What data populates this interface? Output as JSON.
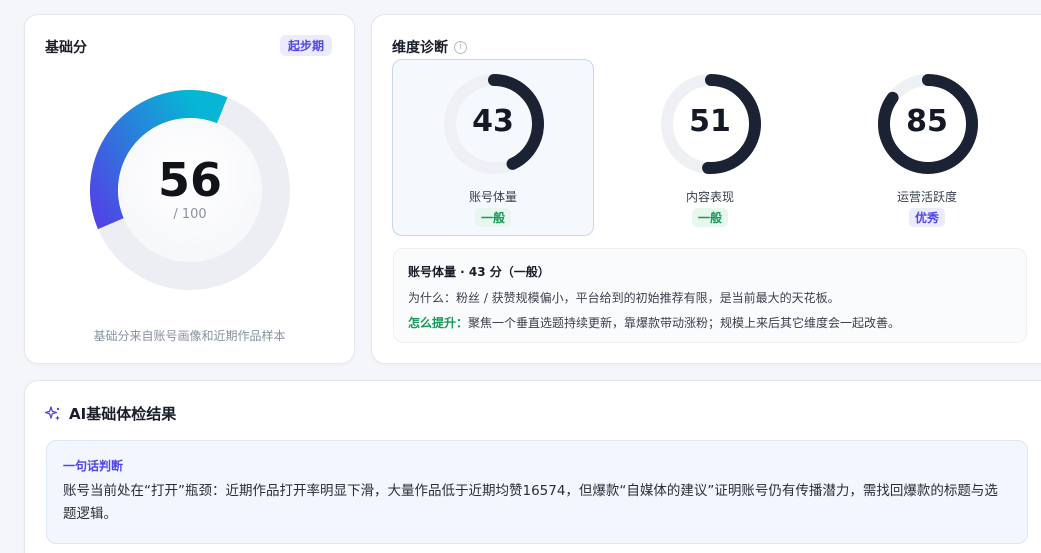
{
  "base_score": {
    "title": "基础分",
    "badge": "起步期",
    "value": 56,
    "max_label": "/ 100",
    "progress": 0.56,
    "note": "基础分来自账号画像和近期作品样本"
  },
  "dimensions": {
    "title": "维度诊断",
    "info_icon": "info-icon",
    "items": [
      {
        "name": "账号体量",
        "value": 43,
        "level": "一般",
        "level_type": "normal",
        "active": true
      },
      {
        "name": "内容表现",
        "value": 51,
        "level": "一般",
        "level_type": "normal",
        "active": false
      },
      {
        "name": "运营活跃度",
        "value": 85,
        "level": "优秀",
        "level_type": "good",
        "active": false
      }
    ],
    "detail": {
      "heading": "账号体量 · 43 分（一般）",
      "why": "为什么：粉丝 / 获赞规模偏小，平台给到的初始推荐有限，是当前最大的天花板。",
      "how_label": "怎么提升：",
      "how_text": "聚焦一个垂直选题持续更新，靠爆款带动涨粉；规模上来后其它维度会一起改善。"
    }
  },
  "ai_result": {
    "title": "AI基础体检结果",
    "icon": "sparkle-icon",
    "verdict_label": "一句话判断",
    "verdict_text": "账号当前处在“打开”瓶颈：近期作品打开率明显下滑，大量作品低于近期均赞16574，但爆款“自媒体的建议”证明账号仍有传播潜力，需找回爆款的标题与选题逻辑。"
  },
  "colors": {
    "ring_dark": "#1a2233",
    "ring_track": "#eef0f4",
    "gauge_start": "#4f46e5",
    "gauge_end": "#06b6d4",
    "green": "#159a57",
    "indigo": "#4f46e5"
  }
}
